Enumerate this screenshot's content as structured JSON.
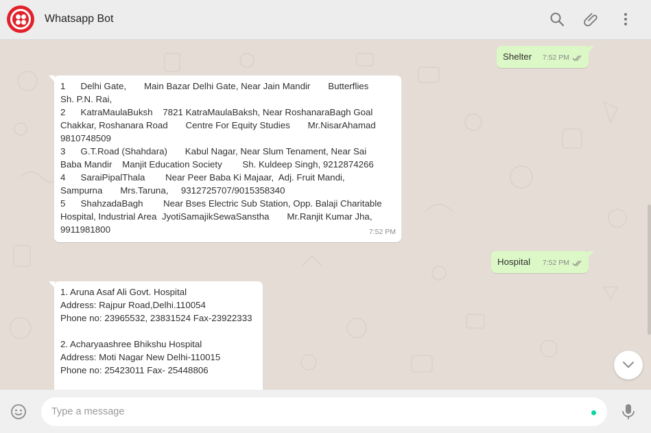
{
  "header": {
    "title": "Whatsapp Bot",
    "icons": [
      "twilio-logo",
      "search-icon",
      "paperclip-icon",
      "more-vertical-icon"
    ]
  },
  "messages": [
    {
      "direction": "out",
      "text": "Shelter",
      "time": "7:52 PM",
      "status": "read"
    },
    {
      "direction": "in",
      "lines": [
        "1      Delhi Gate,       Main Bazar Delhi Gate, Near Jain Mandir       Butterflies",
        "Sh. P.N. Rai,",
        "2      KatraMaulaBuksh    7821 KatraMaulaBaksh, Near RoshanaraBagh Goal",
        "Chakkar, Roshanara Road       Centre For Equity Studies       Mr.NisarAhamad",
        "9810748509",
        "3      G.T.Road (Shahdara)       Kabul Nagar, Near Slum Tenament, Near Sai",
        "Baba Mandir    Manjit Education Society        Sh. Kuldeep Singh, 9212874266",
        "4      SaraiPipalThala        Near Peer Baba Ki Majaar,  Adj. Fruit Mandi,",
        "Sampurna       Mrs.Taruna,     9312725707/9015358340",
        "5      ShahzadaBagh        Near Bses Electric Sub Station, Opp. Balaji Charitable",
        "Hospital, Industrial Area  JyotiSamajikSewaSanstha       Mr.Ranjit Kumar Jha,",
        "9911981800"
      ],
      "time": "7:52 PM"
    },
    {
      "direction": "out",
      "text": "Hospital",
      "time": "7:52 PM",
      "status": "read"
    },
    {
      "direction": "in",
      "lines": [
        "1. Aruna Asaf Ali Govt. Hospital",
        "Address: Rajpur Road,Delhi.110054",
        "Phone no: 23965532, 23831524 Fax-23922333",
        "",
        "2. Acharyaashree Bhikshu Hospital",
        "Address: Moti Nagar New Delhi-110015",
        "Phone no: 25423011 Fax- 25448806"
      ]
    }
  ],
  "composer": {
    "placeholder": "Type a message",
    "icons": [
      "emoji-icon",
      "microphone-icon"
    ]
  },
  "colors": {
    "chat_bg": "#e5ddd5",
    "outgoing_bubble": "#dcf8c6",
    "incoming_bubble": "#ffffff",
    "header_bg": "#ededed",
    "brand_red": "#e1222b",
    "read_ticks": "#8a8a8a"
  }
}
